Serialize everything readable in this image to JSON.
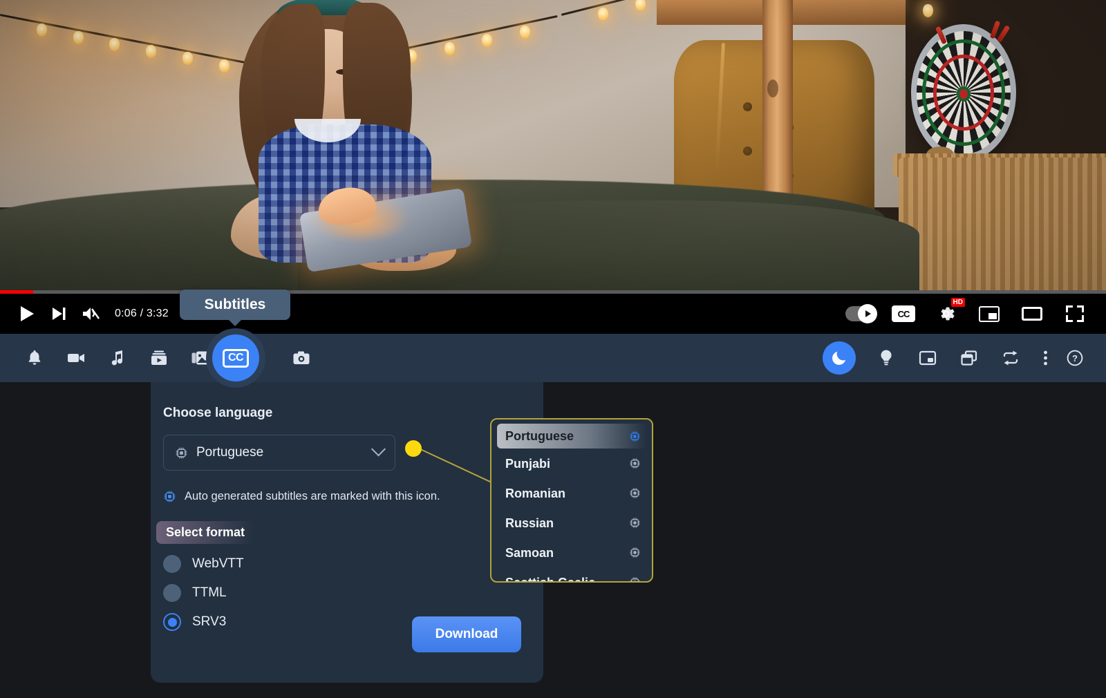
{
  "video": {
    "scene_description": "Girl sitting on bed using a tablet with string lights, armchair, dartboard and wicker basket",
    "progress_percent": 3,
    "time_display": "0:06 / 3:32",
    "tooltip": "Subtitles",
    "controls_left": [
      {
        "name": "play-button",
        "icon": "play-icon"
      },
      {
        "name": "next-button",
        "icon": "next-track-icon"
      },
      {
        "name": "mute-button",
        "icon": "volume-muted-icon"
      }
    ],
    "controls_right": [
      {
        "name": "autoplay-toggle",
        "icon": "autoplay-toggle-icon"
      },
      {
        "name": "captions-button",
        "icon": "cc-icon",
        "label": "CC"
      },
      {
        "name": "settings-button",
        "icon": "gear-icon",
        "badge": "HD"
      },
      {
        "name": "miniplayer-button",
        "icon": "picture-in-picture-icon"
      },
      {
        "name": "theater-button",
        "icon": "theater-mode-icon"
      },
      {
        "name": "fullscreen-button",
        "icon": "fullscreen-icon"
      }
    ]
  },
  "toolbar": {
    "left_items": [
      {
        "name": "notifications-button",
        "icon": "bell-icon"
      },
      {
        "name": "video-download-button",
        "icon": "video-camera-icon"
      },
      {
        "name": "audio-download-button",
        "icon": "music-note-icon"
      },
      {
        "name": "playlist-download-button",
        "icon": "playlist-video-icon"
      },
      {
        "name": "thumbnail-download-button",
        "icon": "images-icon"
      },
      {
        "name": "subtitles-button",
        "icon": "cc-icon",
        "label": "CC",
        "active": true
      },
      {
        "name": "screenshot-button",
        "icon": "camera-icon"
      }
    ],
    "right_items": [
      {
        "name": "dark-mode-button",
        "icon": "moon-icon",
        "active": true
      },
      {
        "name": "ideas-button",
        "icon": "lightbulb-icon"
      },
      {
        "name": "popup-window-button",
        "icon": "popup-window-icon"
      },
      {
        "name": "copy-button",
        "icon": "copy-windows-icon"
      },
      {
        "name": "convert-button",
        "icon": "repeat-convert-icon"
      },
      {
        "name": "more-options-button",
        "icon": "kebab-menu-icon"
      },
      {
        "name": "help-button",
        "icon": "question-circle-icon"
      }
    ]
  },
  "panel": {
    "choose_language_heading": "Choose language",
    "selected_language": "Portuguese",
    "language_chip_icon": "cpu-chip-icon",
    "auto_generated_note": "Auto generated subtitles are marked with this icon.",
    "select_format_heading": "Select format",
    "formats": [
      {
        "label": "WebVTT",
        "selected": false
      },
      {
        "label": "TTML",
        "selected": false
      },
      {
        "label": "SRV3",
        "selected": true
      }
    ],
    "download_button": "Download"
  },
  "dropdown": {
    "items": [
      {
        "label": "Portuguese",
        "highlighted": true,
        "auto_generated": true
      },
      {
        "label": "Punjabi",
        "highlighted": false,
        "auto_generated": true
      },
      {
        "label": "Romanian",
        "highlighted": false,
        "auto_generated": true
      },
      {
        "label": "Russian",
        "highlighted": false,
        "auto_generated": true
      },
      {
        "label": "Samoan",
        "highlighted": false,
        "auto_generated": true
      },
      {
        "label": "Scottish Gaelic",
        "highlighted": false,
        "auto_generated": true
      }
    ]
  },
  "colors": {
    "accent_blue": "#3b82f6",
    "panel_bg": "#22303f",
    "toolbar_bg": "#28364a",
    "page_bg": "#16181c",
    "highlight_yellow": "#ffd90f",
    "dropdown_border": "#b5a33c",
    "progress_red": "#ff0000"
  }
}
